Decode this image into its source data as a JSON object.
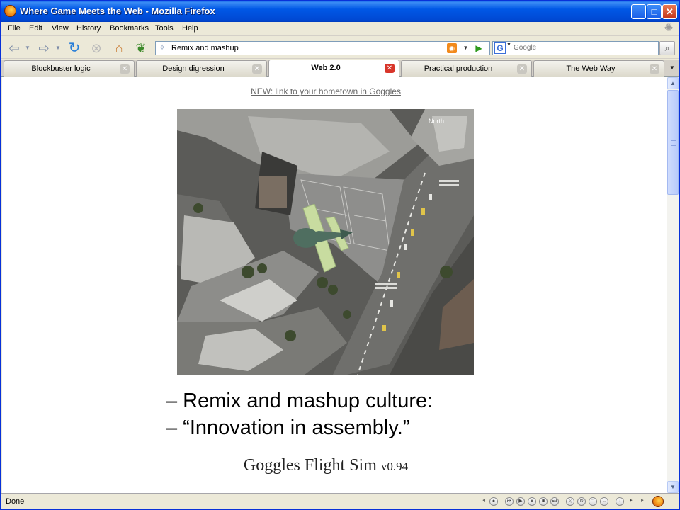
{
  "window": {
    "title": "Where Game Meets the Web - Mozilla Firefox",
    "minimize_label": "_",
    "maximize_label": "□",
    "close_label": "✕"
  },
  "menu": {
    "items": [
      "File",
      "Edit",
      "View",
      "History",
      "Bookmarks",
      "Tools",
      "Help"
    ]
  },
  "nav": {
    "back_icon": "back-arrow-icon",
    "forward_icon": "forward-arrow-icon",
    "reload_icon": "reload-icon",
    "stop_icon": "stop-icon",
    "home_icon": "home-icon",
    "leaf_icon": "leaf-icon",
    "url": "Remix and mashup",
    "search_engine": "G",
    "search_placeholder": "Google"
  },
  "tabs": [
    {
      "label": "Blockbuster logic",
      "active": false
    },
    {
      "label": "Design digression",
      "active": false
    },
    {
      "label": "Web 2.0",
      "active": true
    },
    {
      "label": "Practical production",
      "active": false
    },
    {
      "label": "The Web Way",
      "active": false
    }
  ],
  "content": {
    "link_text": "NEW: link to your hometown in Goggles",
    "map_label": "North",
    "bullets": [
      "– Remix and mashup culture:",
      "– “Innovation in assembly.”"
    ],
    "caption_title": "Goggles Flight Sim ",
    "caption_version": "v0.94"
  },
  "status": {
    "text": "Done"
  },
  "colors": {
    "titlebar": "#0058e6",
    "chrome": "#ece9d8",
    "plane_wing": "#c8dca0",
    "plane_body": "#4f6e60"
  }
}
